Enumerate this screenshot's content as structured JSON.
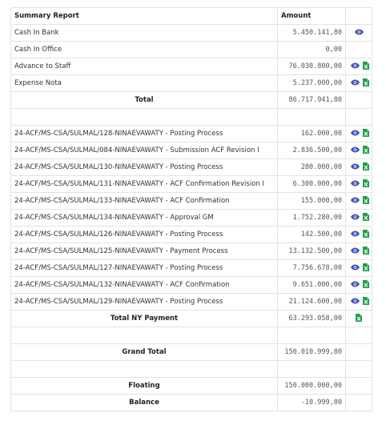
{
  "header": {
    "col1": "Summary Report",
    "col2": "Amount"
  },
  "summary_rows": [
    {
      "label": "Cash In Bank",
      "amount": "5.450.141,80",
      "icons": [
        "eye"
      ]
    },
    {
      "label": "Cash In Office",
      "amount": "0,00",
      "icons": []
    },
    {
      "label": "Advance to Staff",
      "amount": "76.030.800,00",
      "icons": [
        "eye",
        "excel"
      ]
    },
    {
      "label": "Expense Nota",
      "amount": "5.237.000,00",
      "icons": [
        "eye",
        "excel"
      ]
    }
  ],
  "total": {
    "label": "Total",
    "amount": "86.717.941,80"
  },
  "payment_rows": [
    {
      "label": "24-ACF/MS-CSA/SULMAL/128-NINAEVAWATY - Posting Process",
      "amount": "162.000,00"
    },
    {
      "label": "24-ACF/MS-CSA/SULMAL/084-NINAEVAWATY - Submission ACF Revision I",
      "amount": "2.836.500,00"
    },
    {
      "label": "24-ACF/MS-CSA/SULMAL/130-NINAEVAWATY - Posting Process",
      "amount": "280.000,00"
    },
    {
      "label": "24-ACF/MS-CSA/SULMAL/131-NINAEVAWATY - ACF Confirmation Revision I",
      "amount": "6.300.000,00"
    },
    {
      "label": "24-ACF/MS-CSA/SULMAL/133-NINAEVAWATY - ACF Confirmation",
      "amount": "155.000,00"
    },
    {
      "label": "24-ACF/MS-CSA/SULMAL/134-NINAEVAWATY - Approval GM",
      "amount": "1.752.280,00"
    },
    {
      "label": "24-ACF/MS-CSA/SULMAL/126-NINAEVAWATY - Posting Process",
      "amount": "142.500,00"
    },
    {
      "label": "24-ACF/MS-CSA/SULMAL/125-NINAEVAWATY - Payment Process",
      "amount": "13.132.500,00"
    },
    {
      "label": "24-ACF/MS-CSA/SULMAL/127-NINAEVAWATY - Posting Process",
      "amount": "7.756.678,00"
    },
    {
      "label": "24-ACF/MS-CSA/SULMAL/132-NINAEVAWATY - ACF Confirmation",
      "amount": "9.651.000,00"
    },
    {
      "label": "24-ACF/MS-CSA/SULMAL/129-NINAEVAWATY - Posting Process",
      "amount": "21.124.600,00"
    }
  ],
  "total_ny_payment": {
    "label": "Total NY Payment",
    "amount": "63.293.058,00"
  },
  "grand_total": {
    "label": "Grand Total",
    "amount": "150.010.999,80"
  },
  "floating": {
    "label": "Floating",
    "amount": "150.000.000,00"
  },
  "balance": {
    "label": "Balance",
    "amount": "-10.999,80"
  },
  "colors": {
    "eye_icon": "#3f51b5",
    "excel_icon": "#1e9e4a",
    "border": "#e3e3e3"
  }
}
